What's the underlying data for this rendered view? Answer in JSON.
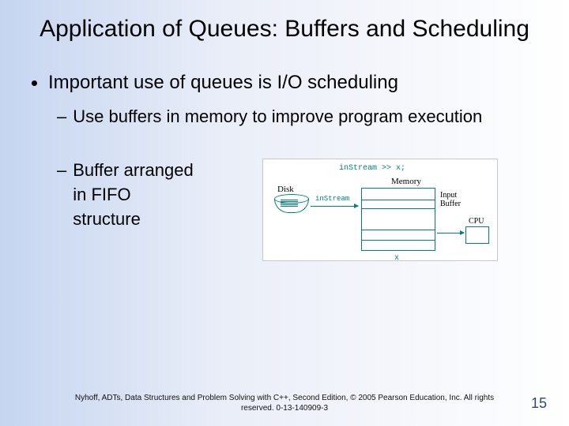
{
  "title": "Application of Queues: Buffers and Scheduling",
  "bullets": {
    "main": "Important use of queues is I/O scheduling",
    "sub1": "Use buffers in memory to improve program execution",
    "sub2_l1": "Buffer arranged",
    "sub2_l2": "in FIFO",
    "sub2_l3": "structure"
  },
  "diagram": {
    "code": "inStream >> x;",
    "disk": "Disk",
    "stream": "inStream",
    "memory": "Memory",
    "input_buffer_l1": "Input",
    "input_buffer_l2": "Buffer",
    "cpu": "CPU",
    "x": "x"
  },
  "footer": "Nyhoff, ADTs, Data Structures and Problem Solving with C++, Second Edition, © 2005 Pearson Education, Inc. All rights reserved. 0-13-140909-3",
  "page": "15"
}
